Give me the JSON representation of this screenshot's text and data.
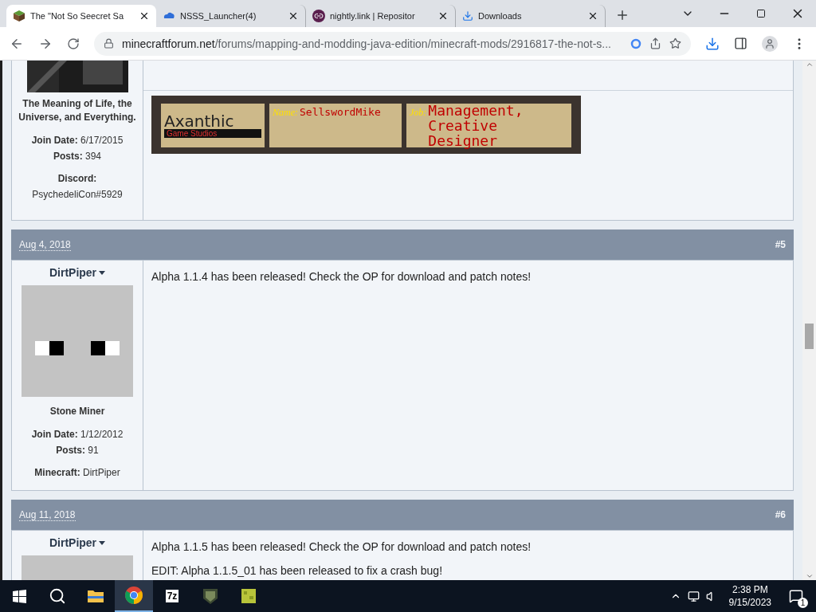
{
  "tabs": [
    {
      "title": "The \"Not So Seecret Sa",
      "selected": true
    },
    {
      "title": "NSSS_Launcher(4)",
      "selected": false
    },
    {
      "title": "nightly.link | Repositor",
      "selected": false
    },
    {
      "title": "Downloads",
      "selected": false
    }
  ],
  "address": {
    "domain": "minecraftforum.net",
    "path": "/forums/mapping-and-modding-java-edition/minecraft-mods/2916817-the-not-s..."
  },
  "posts": [
    {
      "user": {
        "title": "The Meaning of Life, the Universe, and Everything.",
        "stats": [
          {
            "label": "Join Date:",
            "value": "6/17/2015"
          },
          {
            "label": "Posts:",
            "value": "394"
          }
        ],
        "extra": {
          "label": "Discord:",
          "value": "PsychedeliCon#5929"
        }
      },
      "signature": {
        "logo": "Axanthic",
        "logo_sub": "Game Studios",
        "name_label": "Name:",
        "name": "SellswordMike",
        "job_label": "Job:",
        "job": "Management, Creative Designer"
      }
    },
    {
      "date": "Aug 4, 2018",
      "number": "#5",
      "user": {
        "name": "DirtPiper",
        "title": "Stone Miner",
        "stats": [
          {
            "label": "Join Date:",
            "value": "1/12/2012"
          },
          {
            "label": "Posts:",
            "value": "91"
          }
        ],
        "extra": {
          "label": "Minecraft:",
          "value": "DirtPiper"
        }
      },
      "paragraphs": [
        "Alpha 1.1.4 has been released! Check the OP for download and patch notes!"
      ]
    },
    {
      "date": "Aug 11, 2018",
      "number": "#6",
      "user": {
        "name": "DirtPiper"
      },
      "paragraphs": [
        "Alpha 1.1.5 has been released! Check the OP for download and patch notes!",
        "EDIT: Alpha 1.1.5_01 has been released to fix a crash bug!"
      ]
    }
  ],
  "taskbar": {
    "apps": [
      {
        "selected": false
      },
      {
        "selected": true
      },
      {
        "label": "7z",
        "selected": false
      },
      {
        "selected": false
      },
      {
        "selected": false
      }
    ],
    "time": "2:38 PM",
    "date": "9/15/2023",
    "notifications": "1"
  }
}
